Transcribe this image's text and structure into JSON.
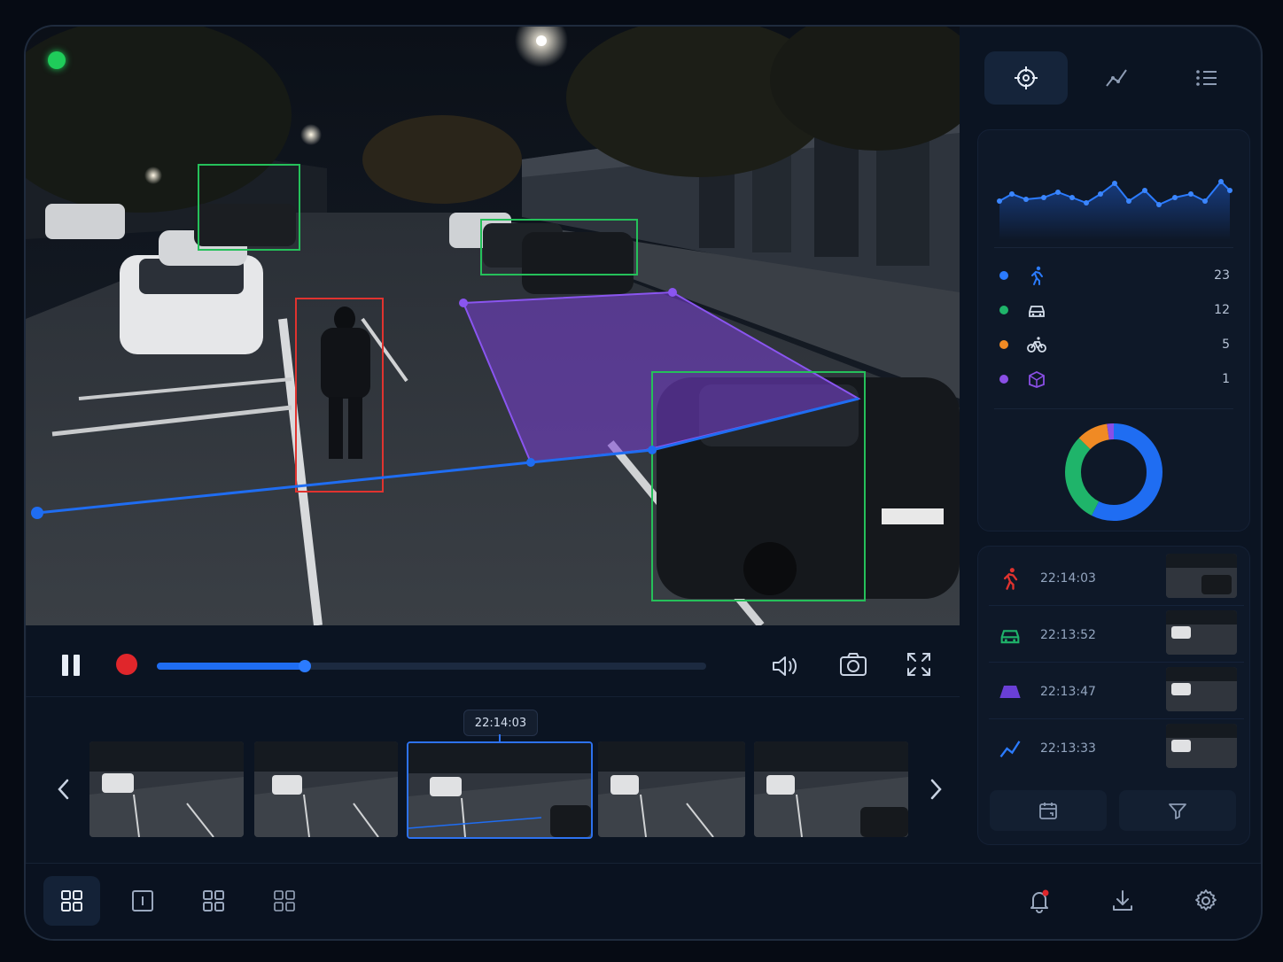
{
  "video": {
    "status_color": "#1fcc5a",
    "detections": [
      {
        "kind": "person",
        "color": "#e0332f"
      },
      {
        "kind": "vehicle",
        "color": "#25c05a"
      },
      {
        "kind": "vehicle",
        "color": "#25c05a"
      },
      {
        "kind": "vehicle",
        "color": "#25c05a"
      }
    ],
    "zone_color": "#7a3fd6",
    "tripwire_color": "#1f6df2"
  },
  "controls": {
    "progress": 0.27,
    "icons": [
      "pause-icon",
      "record-icon",
      "volume-icon",
      "camera-icon",
      "fullscreen-icon"
    ]
  },
  "filmstrip": {
    "current_time": "22:14:03",
    "selected_index": 2,
    "thumbnail_count": 5
  },
  "bottombar": {
    "layouts": [
      "grid-2x2-icon",
      "single-view-icon",
      "grid-alt-icon",
      "grid-outline-icon"
    ],
    "actions": [
      "bell-icon",
      "download-icon",
      "settings-icon"
    ],
    "notification_color": "#e0262b"
  },
  "panel": {
    "tabs": [
      "target-icon",
      "trend-icon",
      "list-icon"
    ],
    "stats": [
      {
        "icon": "person-run-icon",
        "color": "#2b7bff",
        "value": "23"
      },
      {
        "icon": "car-icon",
        "color": "#1fb46a",
        "value": "12"
      },
      {
        "icon": "bicycle-icon",
        "color": "#f08a24",
        "value": "5"
      },
      {
        "icon": "zone-icon",
        "color": "#8a4fe6",
        "value": "1"
      }
    ],
    "events": [
      {
        "icon": "person-run-icon",
        "color": "#e0332f",
        "time": "22:14:03"
      },
      {
        "icon": "car-icon",
        "color": "#1fb46a",
        "time": "22:13:52"
      },
      {
        "icon": "zone-icon",
        "color": "#6a3fd6",
        "time": "22:13:47"
      },
      {
        "icon": "trend-icon",
        "color": "#2b7bff",
        "time": "22:13:33"
      }
    ],
    "filters": [
      "calendar-icon",
      "filter-icon"
    ]
  }
}
